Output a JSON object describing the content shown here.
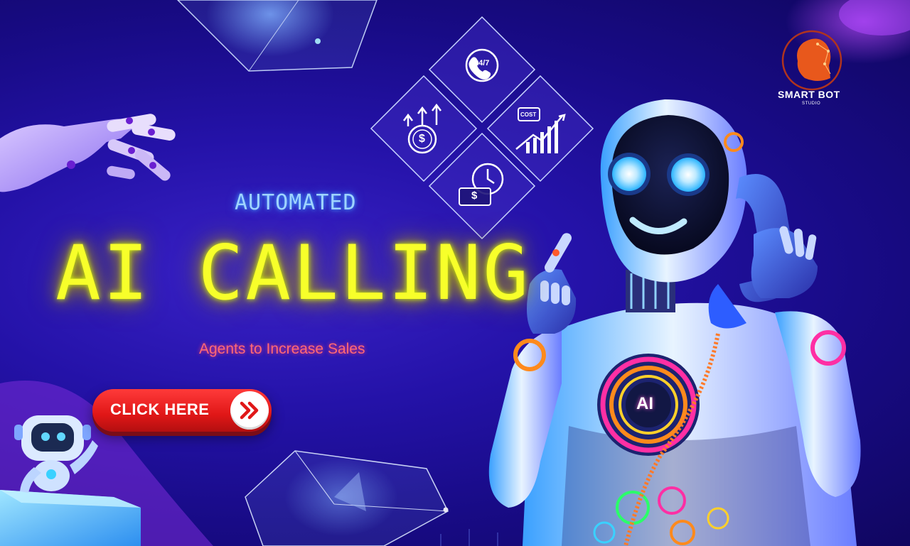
{
  "brand": {
    "name": "SMART BOT",
    "tagline": "STUDIO"
  },
  "hero": {
    "kicker": "AUTOMATED",
    "headline": "AI CALLING",
    "subline": "Agents to Increase Sales",
    "cta_label": "CLICK HERE"
  },
  "icons": [
    {
      "name": "phone-24-7-icon",
      "label": "24/7"
    },
    {
      "name": "rising-dollar-icon"
    },
    {
      "name": "cost-chart-icon",
      "label": "COST"
    },
    {
      "name": "time-money-icon"
    }
  ],
  "robot": {
    "chest_label": "AI"
  },
  "colors": {
    "background": "#2412a8",
    "headline": "#f7ff2a",
    "kicker": "#9fd4ff",
    "subline": "#ff6a74",
    "cta": "#e01717"
  }
}
